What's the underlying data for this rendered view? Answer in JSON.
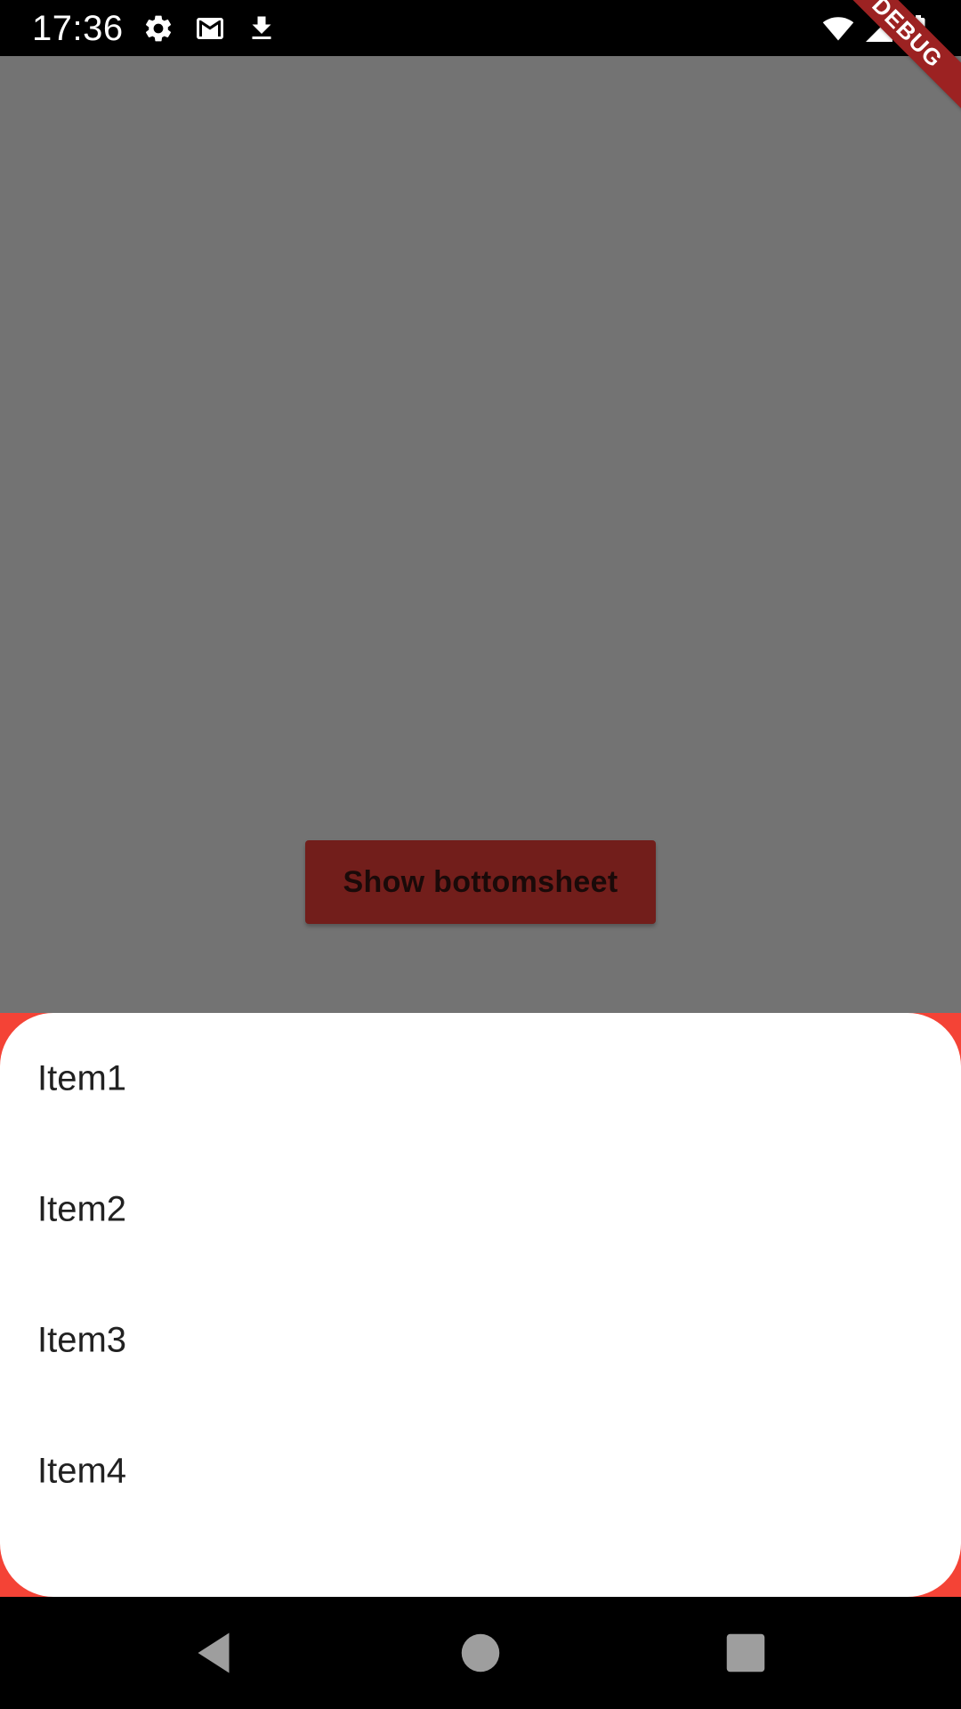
{
  "status_bar": {
    "time": "17:36",
    "left_icons": [
      "settings-icon",
      "gmail-icon",
      "download-icon"
    ],
    "right_icons": [
      "wifi-icon",
      "cell-signal-icon",
      "battery-charging-icon"
    ]
  },
  "debug_banner": {
    "label": "DEBUG"
  },
  "main": {
    "button_label": "Show bottomsheet",
    "button_color": "#721e1b",
    "scrim_color": "#737373"
  },
  "bottom_sheet": {
    "background": "#ffffff",
    "backdrop_color": "#f44336",
    "items": [
      {
        "label": "Item1"
      },
      {
        "label": "Item2"
      },
      {
        "label": "Item3"
      },
      {
        "label": "Item4"
      }
    ]
  },
  "nav_bar": {
    "buttons": [
      "back-icon",
      "home-icon",
      "recents-icon"
    ]
  }
}
